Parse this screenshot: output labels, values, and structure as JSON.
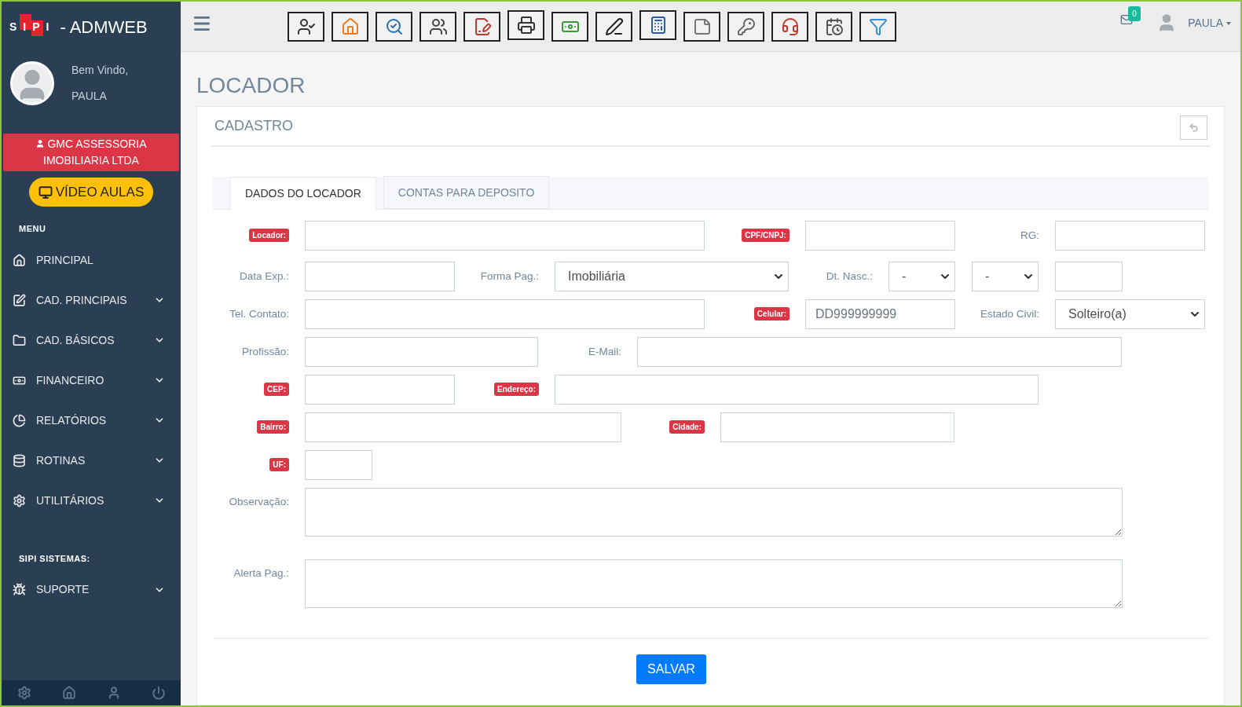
{
  "brand": {
    "letters": "SIPI",
    "name": "- ADMWEB"
  },
  "profile": {
    "greeting": "Bem Vindo,",
    "name": "PAULA"
  },
  "company": "GMC ASSESSORIA IMOBILIARIA LTDA",
  "video_button": "VÍDEO AULAS",
  "sidebar": {
    "sections": [
      {
        "title": "MENU",
        "items": [
          {
            "label": "PRINCIPAL",
            "submenu": false
          },
          {
            "label": "CAD. PRINCIPAIS",
            "submenu": true
          },
          {
            "label": "CAD. BÁSICOS",
            "submenu": true
          },
          {
            "label": "FINANCEIRO",
            "submenu": true
          },
          {
            "label": "RELATÓRIOS",
            "submenu": true
          },
          {
            "label": "ROTINAS",
            "submenu": true
          },
          {
            "label": "UTILITÁRIOS",
            "submenu": true
          }
        ]
      },
      {
        "title": "SIPI SISTEMAS:",
        "items": [
          {
            "label": "SUPORTE",
            "submenu": true
          }
        ]
      }
    ]
  },
  "topbar": {
    "mail_count": "0",
    "user": "PAULA"
  },
  "page_title": "LOCADOR",
  "panel": {
    "title": "CADASTRO",
    "tabs": [
      {
        "label": "DADOS DO LOCADOR",
        "selected": true
      },
      {
        "label": "CONTAS PARA DEPOSITO",
        "selected": false
      }
    ],
    "rows": [
      [
        {
          "label": "Locador:",
          "required": true,
          "kind": "input"
        },
        {
          "label": "CPF/CNPJ:",
          "required": true,
          "kind": "input"
        },
        {
          "label": "RG:",
          "required": false,
          "kind": "input"
        }
      ],
      [
        {
          "label": "Data Exp.:",
          "required": false,
          "kind": "input"
        },
        {
          "label": "Forma Pag.:",
          "required": false,
          "kind": "select",
          "value": "Imobiliária"
        },
        {
          "label": "Dt. Nasc.:",
          "required": false,
          "kind": "select",
          "value": "-"
        },
        {
          "kind": "select",
          "value": "-"
        },
        {
          "kind": "input"
        }
      ],
      [
        {
          "label": "Tel. Contato:",
          "required": false,
          "kind": "input"
        },
        {
          "label": "Celular:",
          "required": true,
          "kind": "input",
          "placeholder": "DD999999999"
        },
        {
          "label": "Estado Civil:",
          "required": false,
          "kind": "select",
          "value": "Solteiro(a)"
        }
      ],
      [
        {
          "label": "Profissão:",
          "required": false,
          "kind": "input"
        },
        {
          "label": "E-Mail:",
          "required": false,
          "kind": "input"
        }
      ],
      [
        {
          "label": "CEP:",
          "required": true,
          "kind": "input"
        },
        {
          "label": "Endereço:",
          "required": true,
          "kind": "input"
        }
      ],
      [
        {
          "label": "Bairro:",
          "required": true,
          "kind": "input"
        },
        {
          "label": "Cidade:",
          "required": true,
          "kind": "input"
        }
      ],
      [
        {
          "label": "UF:",
          "required": true,
          "kind": "input"
        }
      ],
      [
        {
          "label": "Observação:",
          "required": false,
          "kind": "textarea"
        }
      ],
      [
        {
          "label": "Alerta Pag.:",
          "required": false,
          "kind": "textarea"
        }
      ]
    ],
    "save_button": "SALVAR"
  }
}
